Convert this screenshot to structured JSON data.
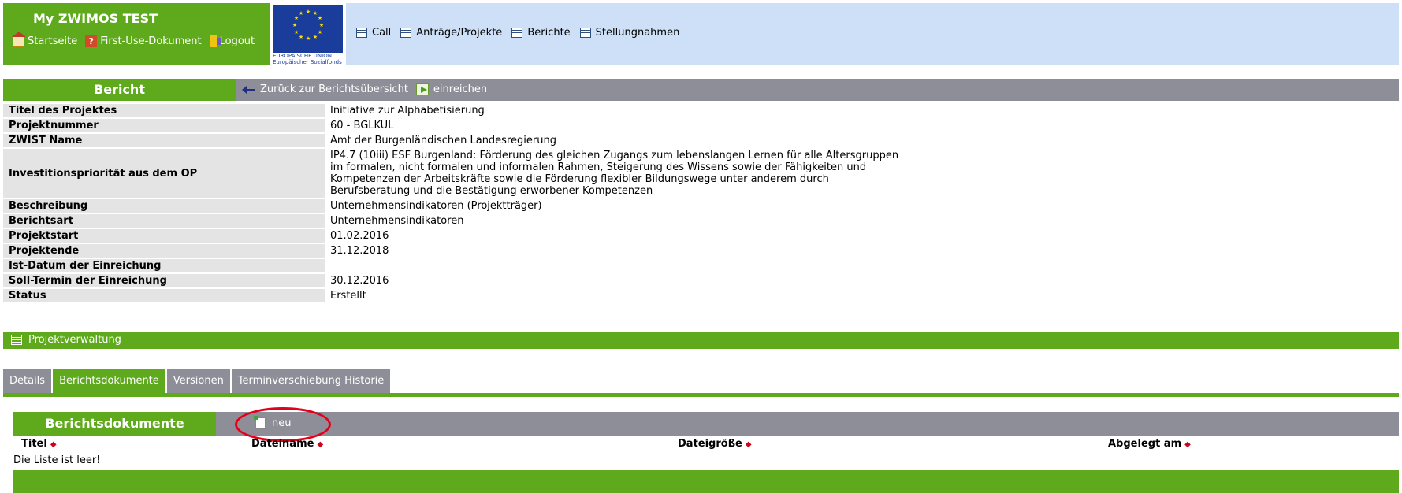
{
  "header": {
    "app_title": "My ZWIMOS TEST",
    "nav": [
      {
        "label": "Startseite",
        "icon": "home-icon"
      },
      {
        "label": "First-Use-Dokument",
        "icon": "help-icon"
      },
      {
        "label": "Logout",
        "icon": "logout-icon"
      }
    ],
    "eu_logo_text": [
      "EUROPÄISCHE UNION",
      "Europäischer Sozialfonds"
    ],
    "menu": [
      {
        "label": "Call"
      },
      {
        "label": "Anträge/Projekte"
      },
      {
        "label": "Berichte"
      },
      {
        "label": "Stellungnahmen"
      }
    ]
  },
  "bericht": {
    "title": "Bericht",
    "back_label": "Zurück zur Berichtsübersicht",
    "submit_label": "einreichen"
  },
  "info_rows": [
    {
      "key": "Titel des Projektes",
      "value": "Initiative zur Alphabetisierung"
    },
    {
      "key": "Projektnummer",
      "value": "60 - BGLKUL"
    },
    {
      "key": "ZWIST Name",
      "value": "Amt der Burgenländischen Landesregierung"
    },
    {
      "key": "Investitionspriorität aus dem OP",
      "value": "IP4.7 (10iii) ESF Burgenland: Förderung des gleichen Zugangs zum lebenslangen Lernen für alle Altersgruppen\nim formalen, nicht formalen und informalen Rahmen, Steigerung des Wissens sowie der Fähigkeiten und\nKompetenzen der Arbeitskräfte sowie die Förderung flexibler Bildungswege unter anderem durch\nBerufsberatung und die Bestätigung erworbener Kompetenzen"
    },
    {
      "key": "Beschreibung",
      "value": "Unternehmensindikatoren (Projektträger)"
    },
    {
      "key": "Berichtsart",
      "value": "Unternehmensindikatoren"
    },
    {
      "key": "Projektstart",
      "value": "01.02.2016"
    },
    {
      "key": "Projektende",
      "value": "31.12.2018"
    },
    {
      "key": "Ist-Datum der Einreichung",
      "value": ""
    },
    {
      "key": "Soll-Termin der Einreichung",
      "value": "30.12.2016"
    },
    {
      "key": "Status",
      "value": "Erstellt"
    }
  ],
  "projektverwaltung": {
    "label": "Projektverwaltung"
  },
  "tabs": [
    {
      "label": "Details",
      "active": false
    },
    {
      "label": "Berichtsdokumente",
      "active": true
    },
    {
      "label": "Versionen",
      "active": false
    },
    {
      "label": "Terminverschiebung Historie",
      "active": false
    }
  ],
  "documents": {
    "title": "Berichtsdokumente",
    "new_label": "neu",
    "columns": [
      "Titel",
      "Dateiname",
      "Dateigröße",
      "Abgelegt am"
    ],
    "sort_marker": "◆",
    "empty_text": "Die Liste ist leer!"
  },
  "colors": {
    "green": "#5ea91c",
    "gray": "#8e8e98",
    "light_blue": "#cde0f7",
    "highlight_red": "#e3001b"
  }
}
